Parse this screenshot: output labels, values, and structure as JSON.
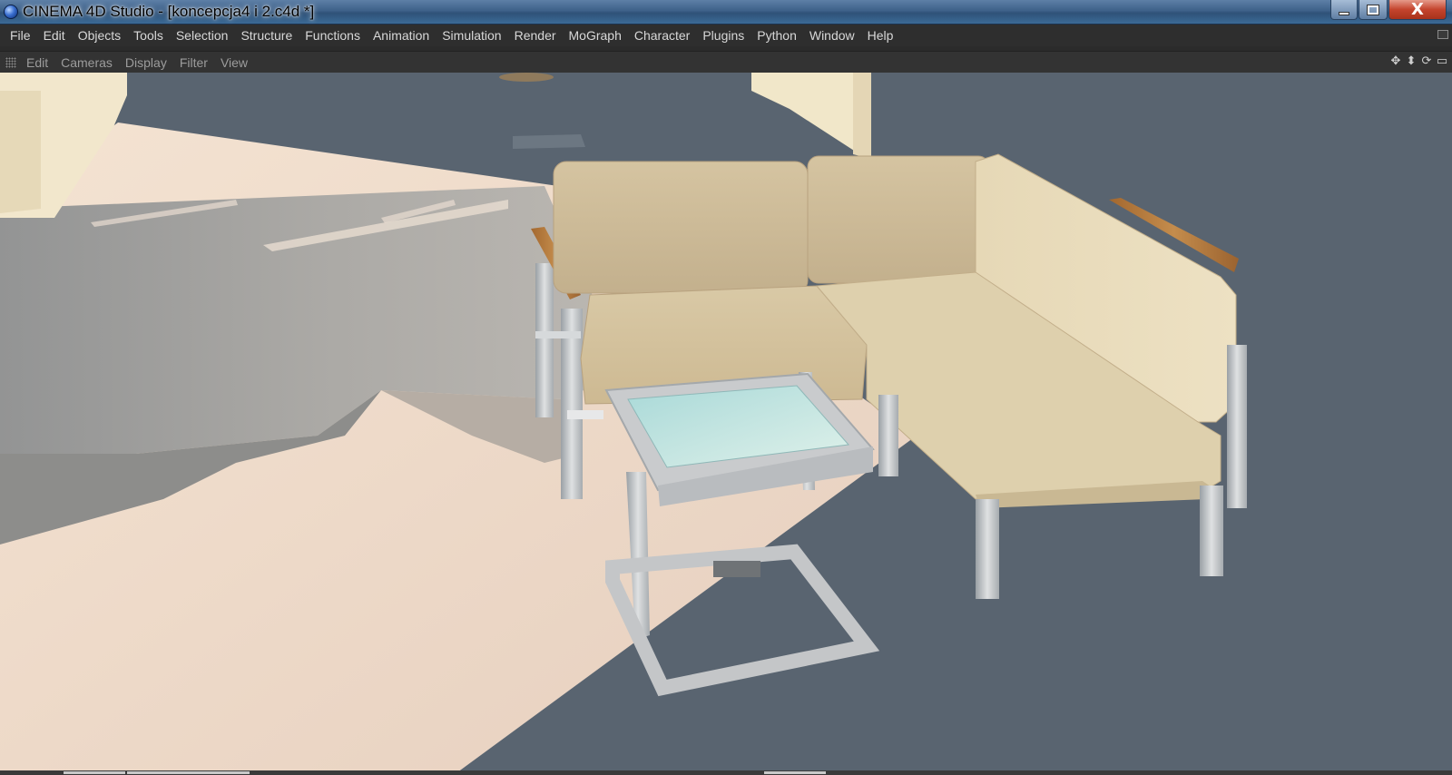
{
  "window": {
    "title": "CINEMA 4D Studio - [koncepcja4 i 2.c4d *]",
    "close_glyph": "X"
  },
  "menubar": {
    "items": [
      "File",
      "Edit",
      "Objects",
      "Tools",
      "Selection",
      "Structure",
      "Functions",
      "Animation",
      "Simulation",
      "Render",
      "MoGraph",
      "Character",
      "Plugins",
      "Python",
      "Window",
      "Help"
    ]
  },
  "viewport_menu": {
    "items": [
      "Edit",
      "Cameras",
      "Display",
      "Filter",
      "View"
    ],
    "icons": [
      "move-view-icon",
      "dolly-view-icon",
      "rotate-view-icon",
      "maximize-view-icon"
    ],
    "icon_glyphs": [
      "✥",
      "⬍",
      "⟳",
      "▭"
    ]
  },
  "colors": {
    "viewport_background": "#596470",
    "floor": "#ead6c4",
    "cushion": "#d8c7a2",
    "armrest_wood": "#b07a3c",
    "frame": "#c4c6c8",
    "glass": "#c7e9e6"
  }
}
